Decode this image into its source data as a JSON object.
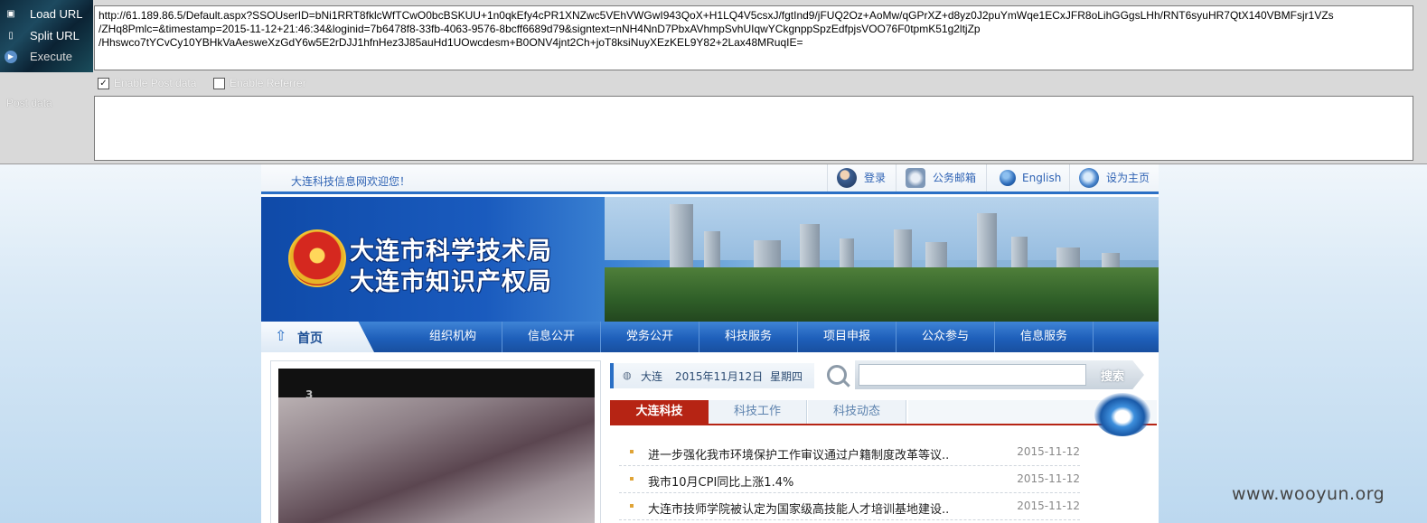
{
  "hackbar": {
    "load_url": "Load URL",
    "split_url": "Split URL",
    "execute": "Execute",
    "url_value": "http://61.189.86.5/Default.aspx?SSOUserID=bNi1RRT8fklcWfTCwO0bcBSKUU+1n0qkEfy4cPR1XNZwc5VEhVWGwI943QoX+H1LQ4V5csxJ/fgtInd9/jFUQ2Oz+AoMw/qGPrXZ+d8yz0J2puYmWqe1ECxJFR8oLihGGgsLHh/RNT6syuHR7QtX140VBMFsjr1VZs\n/ZHq8Pmlc=&timestamp=2015-11-12+21:46:34&loginid=7b6478f8-33fb-4063-9576-8bcff6689d79&signtext=nNH4NnD7PbxAVhmpSvhUIqwYCkgnppSpzEdfpjsVOO76F0tpmK51g2ltjZp\n/Hhswco7tYCvCy10YBHkVaAesweXzGdY6w5E2rDJJ1hfnHez3J85auHd1UOwcdesm+B0ONV4jnt2Ch+joT8ksiNuyXEzKEL9Y82+2Lax48MRuqIE=",
    "enable_post": "Enable Post data",
    "enable_post_checked": true,
    "enable_referrer": "Enable Referrer",
    "enable_referrer_checked": false,
    "post_label": "Post data",
    "post_value": ""
  },
  "site": {
    "welcome": "大连科技信息网欢迎您！",
    "top_links": {
      "login": "登录",
      "mail": "公务邮箱",
      "english": "English",
      "home": "设为主页"
    },
    "banner": {
      "title_line1": "大连市科学技术局",
      "title_line2": "大连市知识产权局"
    },
    "nav": {
      "home": "首页",
      "items": [
        "组织机构",
        "信息公开",
        "党务公开",
        "科技服务",
        "项目申报",
        "公众参与",
        "信息服务"
      ]
    },
    "date_bar": {
      "city": "大连",
      "date": "2015年11月12日",
      "weekday": "星期四"
    },
    "search": {
      "placeholder": "",
      "button": "搜索"
    },
    "tabs": [
      "大连科技",
      "科技工作",
      "科技动态"
    ],
    "video_logo": "3",
    "news": [
      {
        "title": "进一步强化我市环境保护工作审议通过户籍制度改革等议..",
        "date": "2015-11-12"
      },
      {
        "title": "我市10月CPI同比上涨1.4%",
        "date": "2015-11-12"
      },
      {
        "title": "大连市技师学院被认定为国家级高技能人才培训基地建设..",
        "date": "2015-11-12"
      }
    ]
  },
  "watermark": "www.wooyun.org",
  "colors": {
    "nav_blue": "#1e5fba",
    "tab_red": "#b62414",
    "link_blue": "#2f63b4"
  }
}
